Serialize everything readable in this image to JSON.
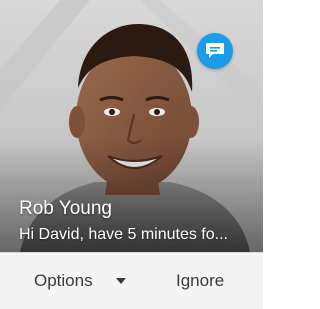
{
  "notification": {
    "caller_name": "Rob Young",
    "message_preview": "Hi David, have 5 minutes fo...",
    "badge_icon": "chat-bubble-icon",
    "colors": {
      "badge": "#1c9be6",
      "action_bar": "#f4f4f4",
      "action_text": "#3b3b3b"
    }
  },
  "actions": {
    "options_label": "Options",
    "options_icon": "caret-down-icon",
    "ignore_label": "Ignore"
  }
}
